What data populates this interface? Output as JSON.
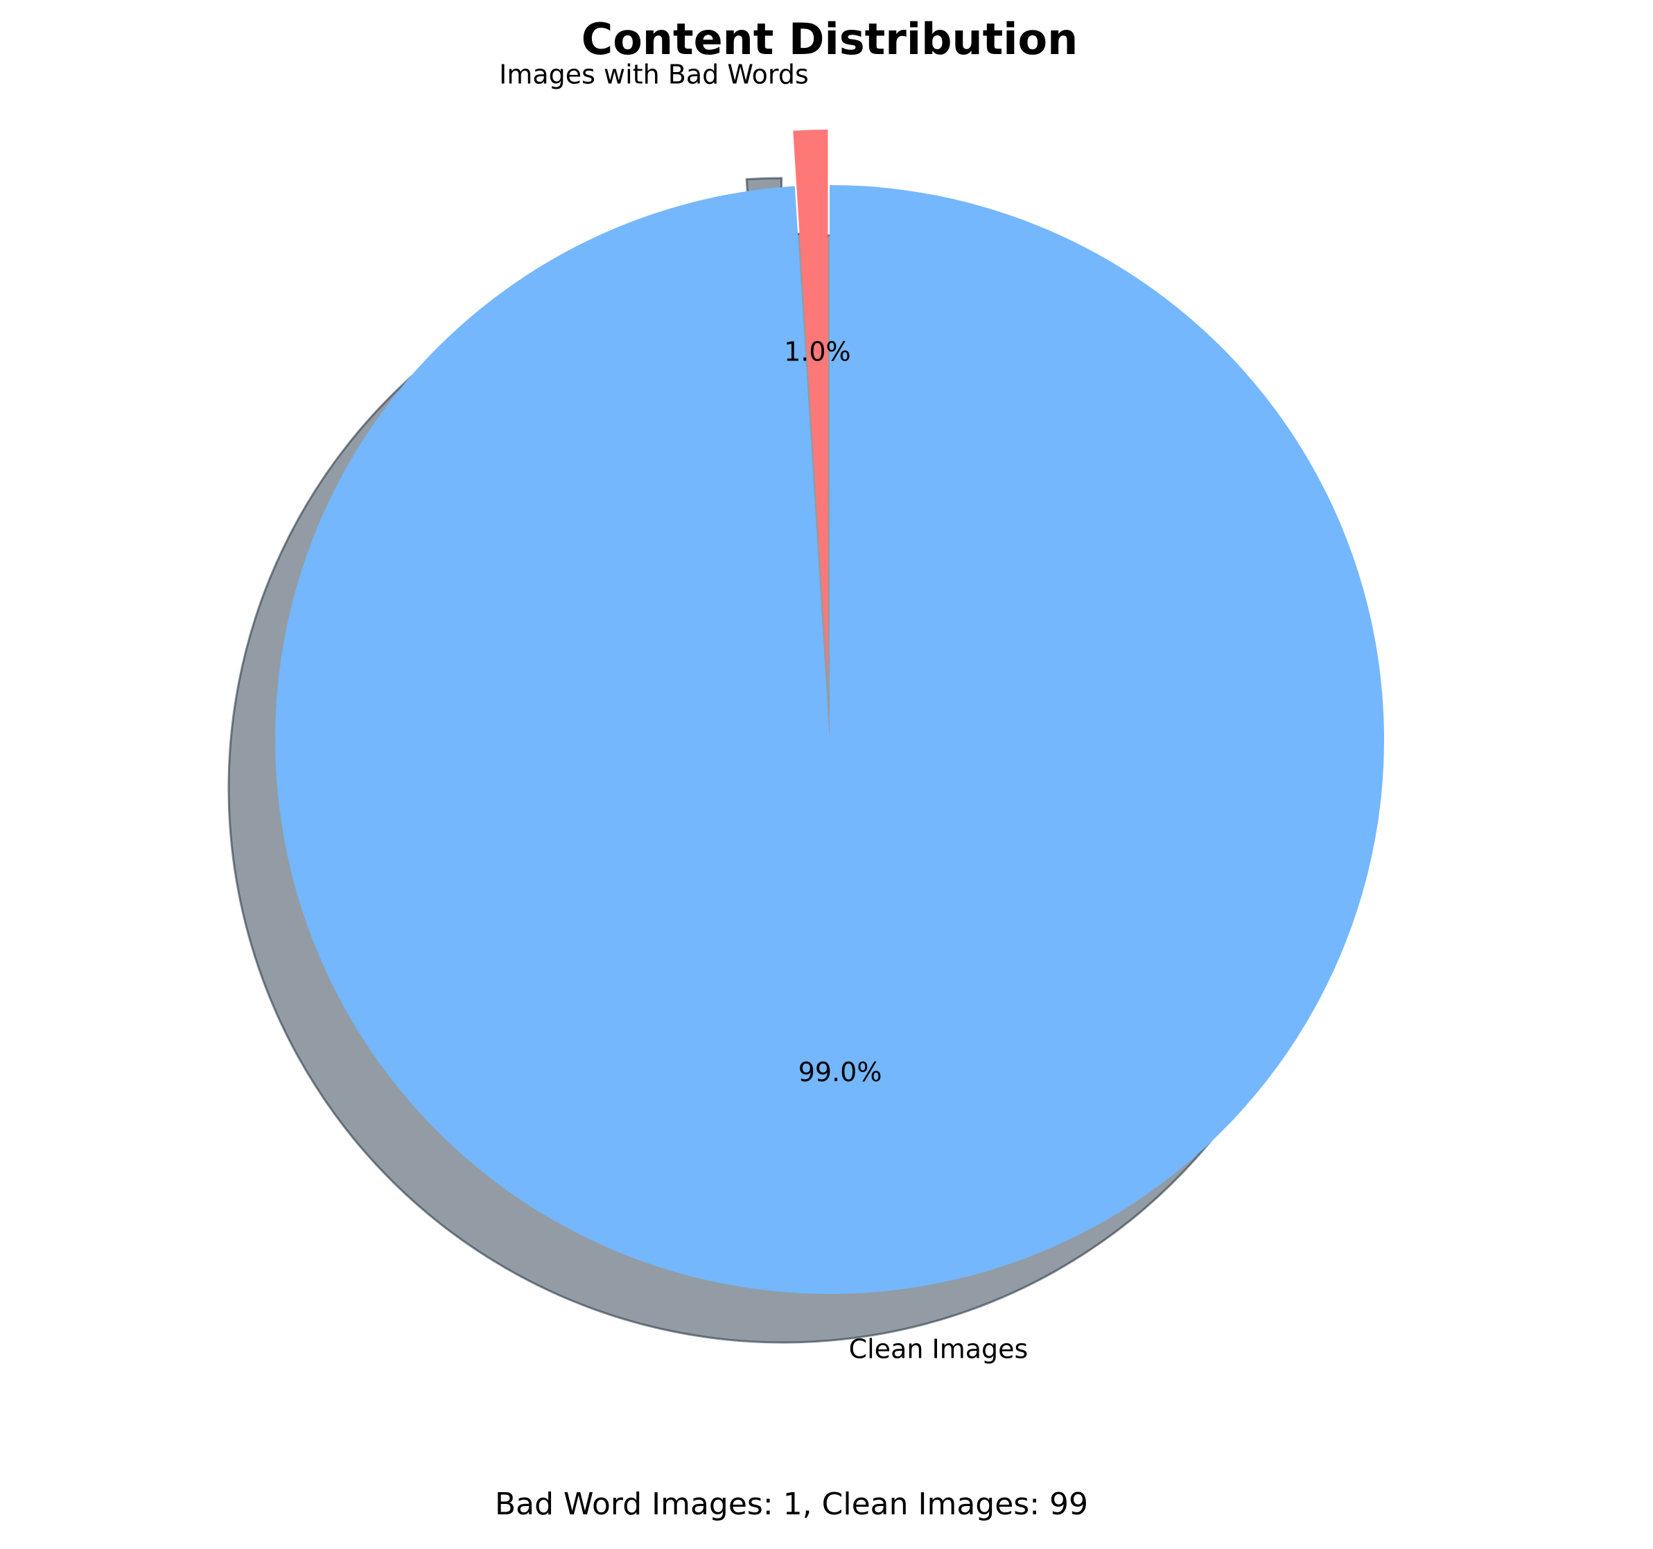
{
  "chart_data": {
    "type": "pie",
    "title": "Content Distribution",
    "categories": [
      "Images with Bad Words",
      "Clean Images"
    ],
    "values": [
      1,
      99
    ],
    "percent_labels": [
      "1.0%",
      "99.0%"
    ],
    "colors": [
      "#ff7878",
      "#74b7fd"
    ],
    "shadow": true,
    "exploded": [
      "Images with Bad Words"
    ],
    "caption": "Bad Word Images: 1, Clean Images: 99"
  }
}
